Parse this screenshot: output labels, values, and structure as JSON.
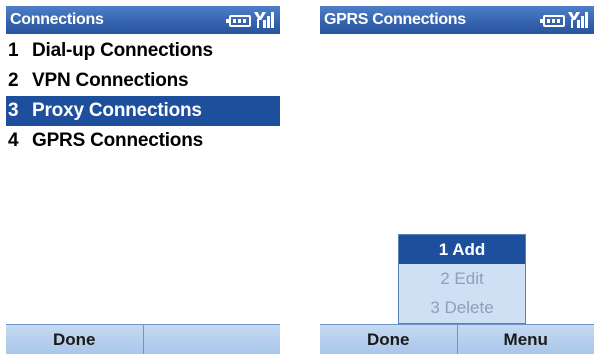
{
  "left_screen": {
    "title": "Connections",
    "items": [
      {
        "num": "1",
        "label": "Dial-up Connections"
      },
      {
        "num": "2",
        "label": "VPN Connections"
      },
      {
        "num": "3",
        "label": "Proxy Connections"
      },
      {
        "num": "4",
        "label": "GPRS Connections"
      }
    ],
    "softkeys": {
      "left": "Done",
      "right": ""
    }
  },
  "right_screen": {
    "title": "GPRS Connections",
    "popup": [
      {
        "label": "1 Add"
      },
      {
        "label": "2 Edit"
      },
      {
        "label": "3 Delete"
      }
    ],
    "softkeys": {
      "left": "Done",
      "right": "Menu"
    }
  },
  "icons": {
    "battery": "battery-icon",
    "signal": "signal-strength-icon"
  },
  "colors": {
    "titlebar": "#3562ad",
    "selection": "#1d4f9c",
    "softkey_bar": "#b7cfee"
  }
}
